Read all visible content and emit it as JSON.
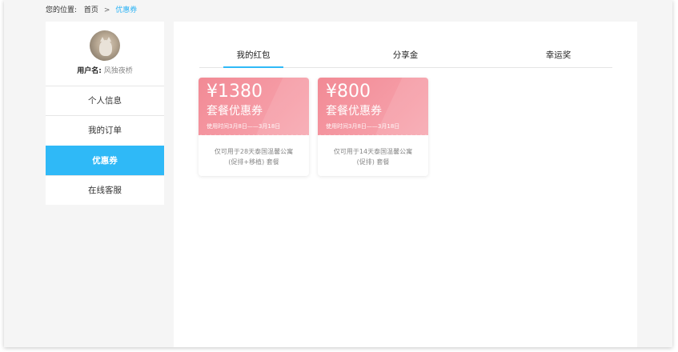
{
  "breadcrumb": {
    "label": "您的位置:",
    "home": "首页",
    "separator": ">",
    "current": "优惠券"
  },
  "sidebar": {
    "username_label": "用户名:",
    "username_value": "风独夜桥",
    "items": [
      {
        "label": "个人信息",
        "active": false
      },
      {
        "label": "我的订单",
        "active": false
      },
      {
        "label": "优惠券",
        "active": true
      },
      {
        "label": "在线客服",
        "active": false
      }
    ]
  },
  "tabs": [
    {
      "label": "我的红包",
      "active": true
    },
    {
      "label": "分享金",
      "active": false
    },
    {
      "label": "幸运奖",
      "active": false
    }
  ],
  "coupons": [
    {
      "amount": "¥1380",
      "title": "套餐优惠券",
      "period": "使用时间3月8日——3月18日",
      "desc_line1": "仅可用于28天泰国温馨公寓",
      "desc_line2": "(促排+移植) 套餐"
    },
    {
      "amount": "¥800",
      "title": "套餐优惠券",
      "period": "使用时间3月8日——3月18日",
      "desc_line1": "仅可用于14天泰国温馨公寓",
      "desc_line2": "(促排) 套餐"
    }
  ],
  "colors": {
    "accent": "#2fb9f7",
    "coupon": "#f28a95",
    "background": "#f5f5f5"
  }
}
